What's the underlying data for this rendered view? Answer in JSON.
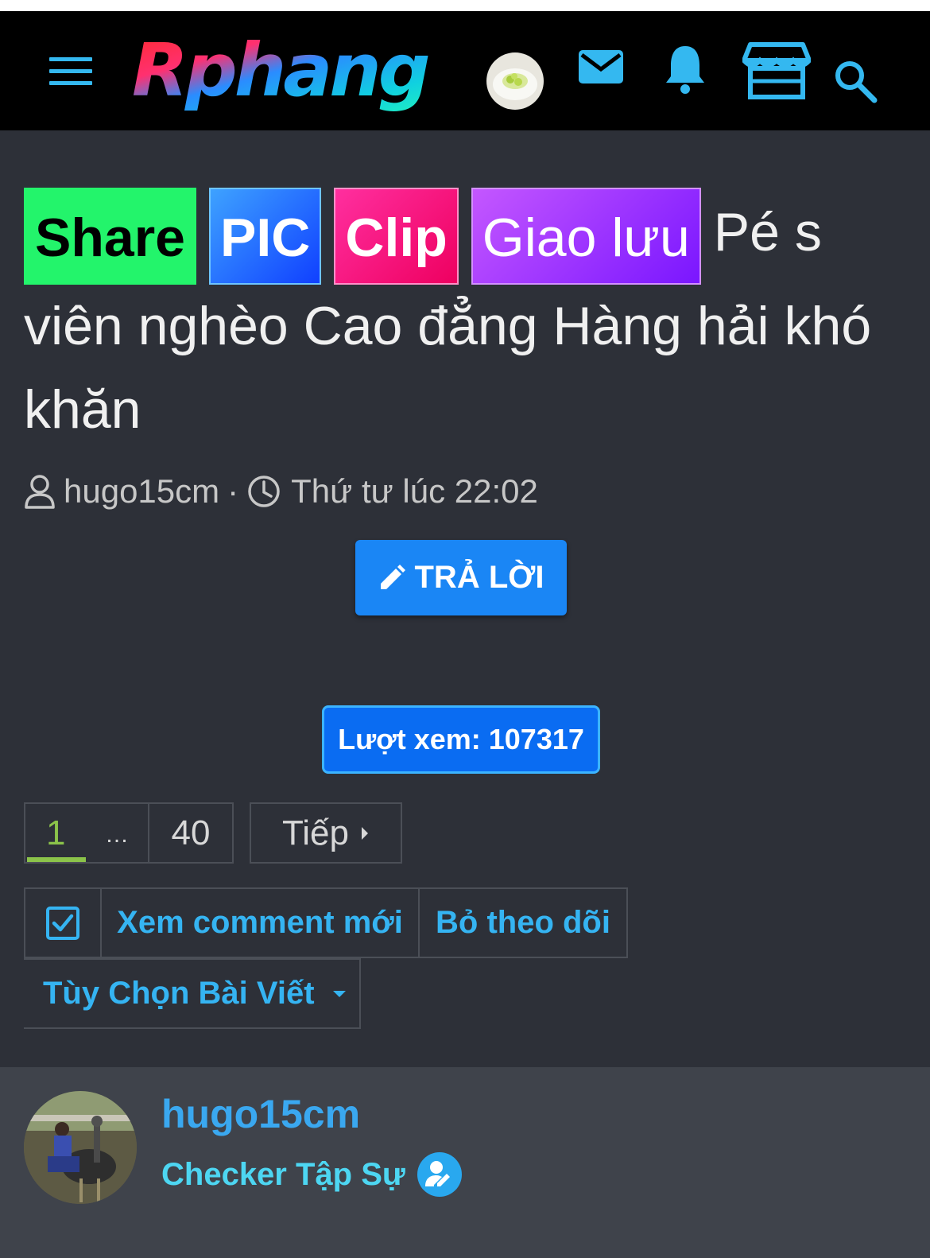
{
  "header": {
    "logo_text": "Rphang",
    "icons": [
      "menu-icon",
      "user-avatar",
      "mail-icon",
      "bell-icon",
      "store-icon",
      "search-icon"
    ]
  },
  "thread": {
    "tags": [
      "Share",
      "PIC",
      "Clip",
      "Giao lưu"
    ],
    "title": "Pé s viên nghèo Cao đẳng Hàng hải khó khăn",
    "author": "hugo15cm",
    "separator": "·",
    "time": "Thứ tư lúc 22:02"
  },
  "reply_button": "TRẢ LỜI",
  "views_label": "Lượt xem: 107317",
  "pagination": {
    "current": "1",
    "ellipsis": "…",
    "last": "40",
    "next": "Tiếp"
  },
  "actions": {
    "view_new": "Xem comment mới",
    "unfollow": "Bỏ theo dõi",
    "options": "Tùy Chọn Bài Viết"
  },
  "post": {
    "username": "hugo15cm",
    "rank": "Checker Tập Sự"
  },
  "colors": {
    "accent": "#1a86f5",
    "link": "#35b4f2",
    "background": "#2d3038",
    "header": "#000000"
  }
}
